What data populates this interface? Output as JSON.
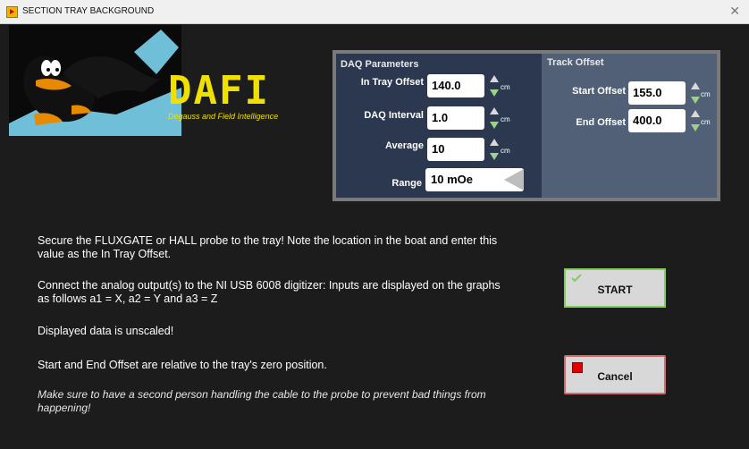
{
  "window": {
    "title": "SECTION TRAY BACKGROUND"
  },
  "branding": {
    "name": "DAFI",
    "subtitle": "Degauss and Field Intelligence"
  },
  "daq": {
    "title": "DAQ Parameters",
    "in_tray_offset": {
      "label": "In Tray Offset",
      "value": "140.0",
      "unit": "cm"
    },
    "daq_interval": {
      "label": "DAQ Interval",
      "value": "1.0",
      "unit": "cm"
    },
    "average": {
      "label": "Average",
      "value": "10",
      "unit": "cm"
    },
    "range": {
      "label": "Range",
      "value": "10 mOe"
    }
  },
  "track": {
    "title": "Track Offset",
    "start_offset": {
      "label": "Start Offset",
      "value": "155.0",
      "unit": "cm"
    },
    "end_offset": {
      "label": "End Offset",
      "value": "400.0",
      "unit": "cm"
    }
  },
  "instructions": {
    "line1": "Secure the FLUXGATE or HALL probe to the tray! Note the location in the boat and enter this value as the In Tray Offset.",
    "line2": "Connect the analog output(s) to the NI USB 6008 digitizer: Inputs are displayed on the graphs as follows a1 = X, a2 = Y and a3 = Z",
    "line3": "Displayed data is unscaled!",
    "line4": "Start and End Offset are relative to the tray's zero position.",
    "line5": "Make sure to have a second person handling the cable to the probe to prevent bad things from happening!"
  },
  "buttons": {
    "start": "START",
    "cancel": "Cancel"
  },
  "icons": {
    "window": "app-icon",
    "start": "check-icon",
    "cancel": "stop-icon",
    "close": "close-icon"
  },
  "colors": {
    "brand": "#f0e000",
    "daq_bg": "#2b3850",
    "track_bg": "#515f77",
    "start_border": "#7fcf5a",
    "cancel_border": "#d06a6a"
  }
}
